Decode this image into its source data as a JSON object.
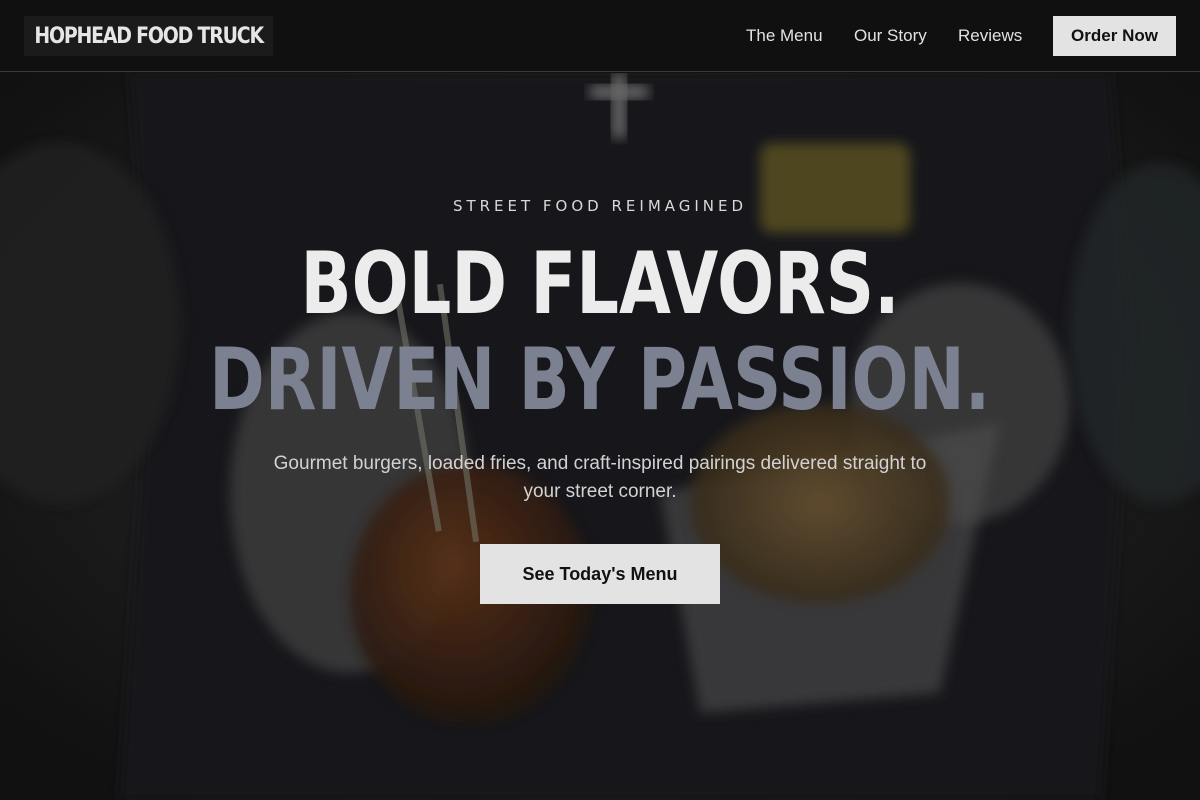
{
  "header": {
    "brand": "HOPHEAD FOOD TRUCK",
    "nav": [
      "The Menu",
      "Our Story",
      "Reviews"
    ],
    "order_label": "Order Now"
  },
  "hero": {
    "eyebrow": "STREET FOOD REIMAGINED",
    "headline_line1": "BOLD FLAVORS.",
    "headline_line2": "DRIVEN BY PASSION.",
    "subtext": "Gourmet burgers, loaded fries, and craft-inspired pairings delivered straight to your street corner.",
    "cta_label": "See Today's Menu"
  },
  "colors": {
    "header_bg": "#101010",
    "button_bg": "#e3e3e3",
    "headline_primary": "#ececec",
    "headline_accent": "#7b8191"
  }
}
